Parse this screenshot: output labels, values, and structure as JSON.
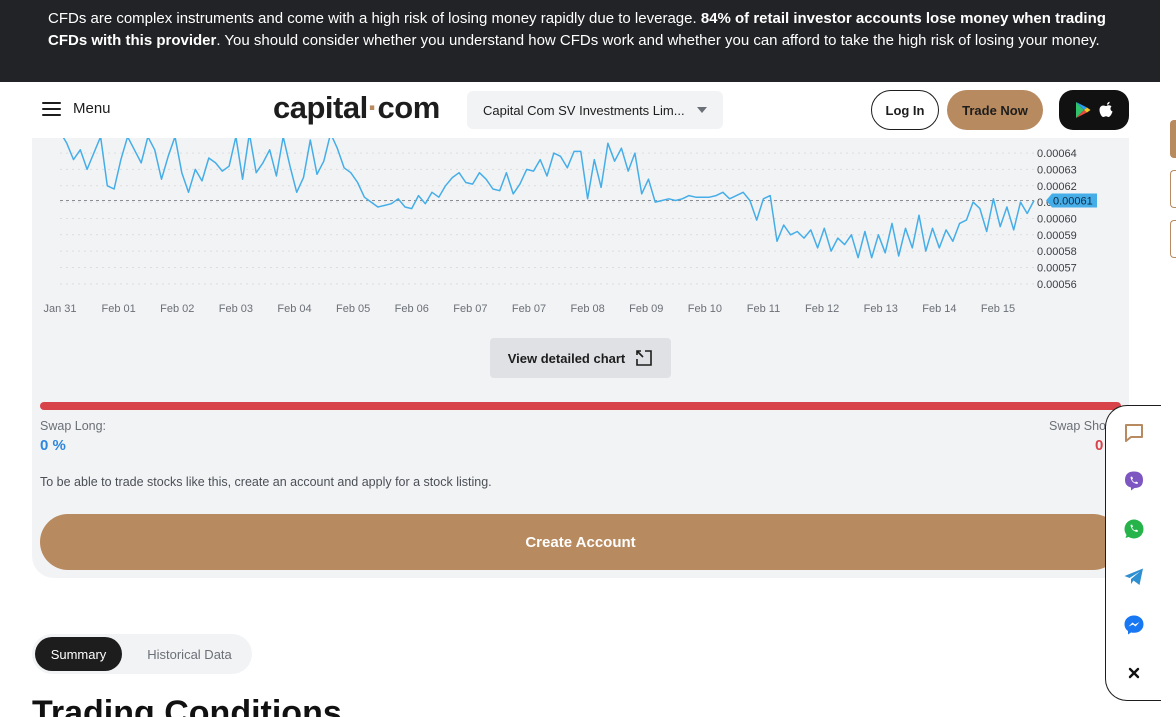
{
  "risk_banner": {
    "text_start": "CFDs are complex instruments and come with a high risk of losing money rapidly due to leverage. ",
    "text_bold": "84% of retail investor accounts lose money when trading CFDs with this provider",
    "text_end": ". You should consider whether you understand how CFDs work and whether you can afford to take the high risk of losing your money."
  },
  "header": {
    "menu_label": "Menu",
    "logo_left": "capital",
    "logo_dot": "·",
    "logo_right": "com",
    "entity_selected": "Capital Com SV Investments Lim...",
    "login_label": "Log In",
    "trade_label": "Trade Now",
    "store_icons": [
      "google-play-icon",
      "apple-icon"
    ]
  },
  "chart_data": {
    "type": "line",
    "title": "",
    "xlabel": "",
    "ylabel": "",
    "x_ticks": [
      "Jan 31",
      "Feb 01",
      "Feb 02",
      "Feb 03",
      "Feb 04",
      "Feb 05",
      "Feb 06",
      "Feb 07",
      "Feb 07",
      "Feb 08",
      "Feb 09",
      "Feb 10",
      "Feb 11",
      "Feb 12",
      "Feb 13",
      "Feb 14",
      "Feb 15"
    ],
    "y_ticks": [
      "0.00064",
      "0.00063",
      "0.00062",
      "0.00061",
      "0.00060",
      "0.00059",
      "0.00058",
      "0.00057",
      "0.00056"
    ],
    "ylim": [
      0.000555,
      0.000648
    ],
    "current_value": "0.00061",
    "reference_value": 0.000611,
    "series": [
      {
        "color": "#45aee8",
        "values": [
          0.000653,
          0.000646,
          0.000636,
          0.000642,
          0.00063,
          0.00064,
          0.00065,
          0.00062,
          0.000618,
          0.000636,
          0.00065,
          0.000642,
          0.000634,
          0.00065,
          0.000642,
          0.000624,
          0.000638,
          0.00065,
          0.000628,
          0.000616,
          0.00063,
          0.000623,
          0.000637,
          0.000634,
          0.000629,
          0.000632,
          0.00065,
          0.000624,
          0.000652,
          0.000628,
          0.000634,
          0.000642,
          0.000626,
          0.00065,
          0.000632,
          0.000616,
          0.000625,
          0.000648,
          0.000627,
          0.000635,
          0.000652,
          0.000643,
          0.000631,
          0.000628,
          0.000622,
          0.000613,
          0.00061,
          0.000607,
          0.000608,
          0.000609,
          0.000612,
          0.000607,
          0.000606,
          0.000614,
          0.000609,
          0.000616,
          0.000613,
          0.00062,
          0.000625,
          0.000628,
          0.000622,
          0.000621,
          0.000628,
          0.000624,
          0.000618,
          0.000617,
          0.000628,
          0.000615,
          0.000621,
          0.00063,
          0.000629,
          0.000636,
          0.000626,
          0.00064,
          0.000638,
          0.000631,
          0.000641,
          0.000641,
          0.000612,
          0.000636,
          0.000619,
          0.000646,
          0.000635,
          0.000643,
          0.000629,
          0.00064,
          0.000615,
          0.000624,
          0.00061,
          0.000611,
          0.000612,
          0.000611,
          0.000612,
          0.000614,
          0.000613,
          0.000613,
          0.000613,
          0.000614,
          0.000616,
          0.000612,
          0.000614,
          0.000616,
          0.000611,
          0.000599,
          0.000612,
          0.000614,
          0.000586,
          0.000596,
          0.00059,
          0.000592,
          0.000588,
          0.000593,
          0.000582,
          0.000594,
          0.00058,
          0.000588,
          0.000584,
          0.00059,
          0.000576,
          0.000592,
          0.000576,
          0.00059,
          0.000579,
          0.000597,
          0.000577,
          0.000594,
          0.000582,
          0.000602,
          0.00058,
          0.000594,
          0.000582,
          0.000593,
          0.000586,
          0.000597,
          0.000599,
          0.00061,
          0.000606,
          0.000592,
          0.000612,
          0.000595,
          0.000607,
          0.000593,
          0.00061,
          0.000603,
          0.000611
        ]
      }
    ]
  },
  "detail_button": {
    "label": "View detailed chart"
  },
  "swap": {
    "long_label": "Swap Long:",
    "long_value": "0 %",
    "long_share": 0,
    "short_label": "Swap Sho",
    "short_value": "0"
  },
  "note": "To be able to trade stocks like this, create an account and apply for a stock listing.",
  "create_button": {
    "label": "Create Account"
  },
  "tabs": [
    {
      "label": "Summary",
      "active": true
    },
    {
      "label": "Historical Data",
      "active": false
    }
  ],
  "section_title": "Trading Conditions",
  "contact_widget": {
    "icons": [
      "chat-icon",
      "viber-icon",
      "whatsapp-icon",
      "telegram-icon",
      "messenger-icon",
      "close-icon"
    ]
  },
  "colors": {
    "accent": "#b88a5f",
    "line": "#45aee8",
    "short_bar": "#d8434a",
    "long_text": "#2e86de",
    "banner_bg": "#222326"
  }
}
